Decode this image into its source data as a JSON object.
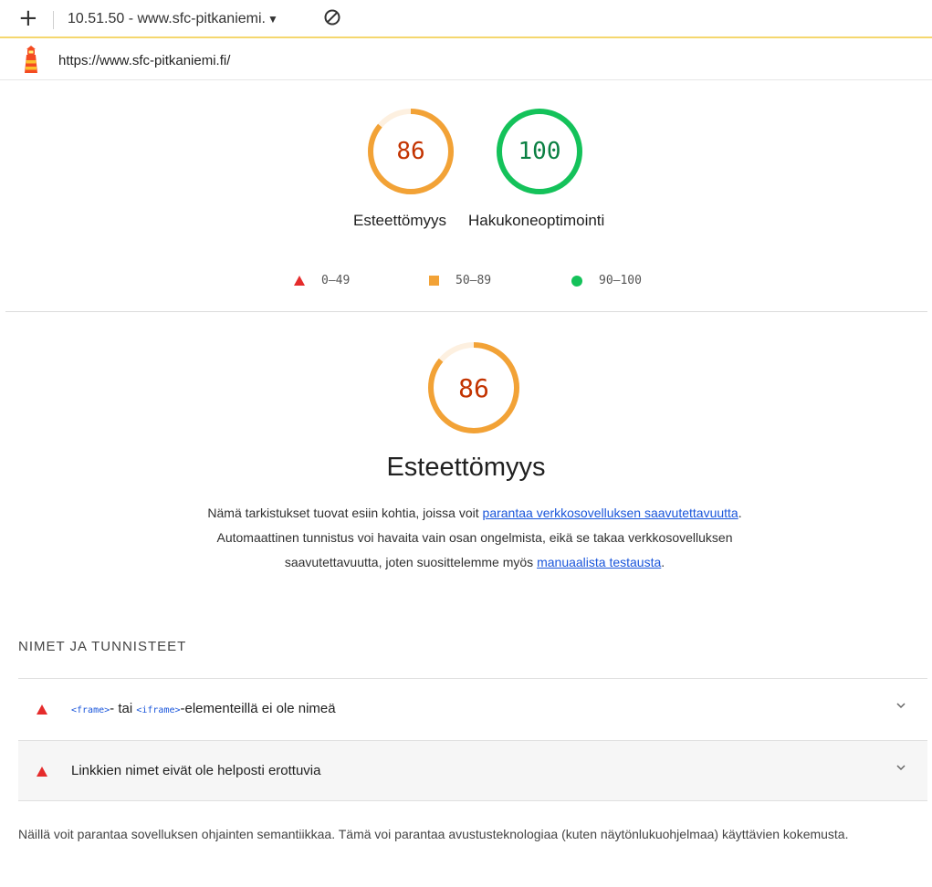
{
  "browser": {
    "tab_title": "10.51.50 - www.sfc-pitkaniemi.",
    "url": "https://www.sfc-pitkaniemi.fi/"
  },
  "icons": {
    "new_tab": "plus-icon",
    "tab_dropdown": "caret-down-icon",
    "block": "no-entry-icon",
    "lighthouse": "lighthouse-logo-icon",
    "menu": "vertical-dots-icon",
    "expand": "chevron-down-icon"
  },
  "scores": [
    {
      "value": "86",
      "label": "Esteettömyys",
      "color": "#f2a236"
    },
    {
      "value": "100",
      "label": "Hakukoneoptimointi",
      "color": "#14c25a"
    }
  ],
  "legend": [
    {
      "range": "0–49",
      "color": "#e52b2b"
    },
    {
      "range": "50–89",
      "color": "#f2a236"
    },
    {
      "range": "90–100",
      "color": "#14c25a"
    }
  ],
  "category": {
    "score": "86",
    "title": "Esteettömyys",
    "desc_part1": "Nämä tarkistukset tuovat esiin kohtia, joissa voit ",
    "link1": "parantaa verkkosovelluksen saavutettavuutta",
    "desc_part2": ". Automaattinen tunnistus voi havaita vain osan ongelmista, eikä se takaa verkkosovelluksen saavutettavuutta, joten suosittelemme myös ",
    "link2": "manuaalista testausta",
    "desc_part3": "."
  },
  "group": {
    "title": "NIMET JA TUNNISTEET",
    "audits": [
      {
        "code1": "<frame>",
        "middle": "- tai ",
        "code2": "<iframe>",
        "rest": "-elementeillä ei ole nimeä"
      },
      {
        "text": "Linkkien nimet eivät ole helposti erottuvia"
      }
    ],
    "description": "Näillä voit parantaa sovelluksen ohjainten semantiikkaa. Tämä voi parantaa avustusteknologiaa (kuten näytönlukuohjelmaa) käyttävien kokemusta."
  }
}
